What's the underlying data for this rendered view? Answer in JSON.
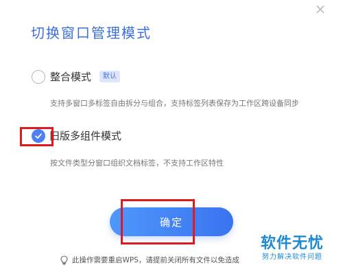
{
  "dialog": {
    "title": "切换窗口管理模式",
    "close_icon": "×"
  },
  "options": [
    {
      "label": "整合模式",
      "badge": "默认",
      "description": "支持多窗口多标签自由拆分与组合，支持标签列表保存为工作区跨设备同步",
      "checked": false
    },
    {
      "label": "旧版多组件模式",
      "description": "按文件类型分窗口组织文档标签，不支持工作区特性",
      "checked": true
    }
  ],
  "confirm_button": {
    "label": "确定"
  },
  "notice": {
    "icon": "lightbulb-icon",
    "text": "此操作需要重启WPS，请提前关闭所有文件以免造成"
  },
  "watermark": {
    "main": "软件无忧",
    "sub": "努力解决软件问题"
  },
  "colors": {
    "accent": "#3a6fdc",
    "button_start": "#4f97fb",
    "button_end": "#3a73ef",
    "annotation": "#e0191f",
    "watermark": "#1a8ad6"
  }
}
